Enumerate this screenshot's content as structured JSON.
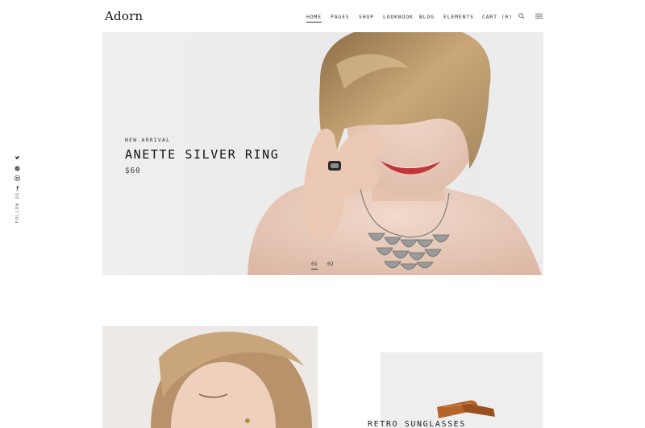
{
  "brand": {
    "logo": "Adorn"
  },
  "nav": {
    "items": [
      {
        "label": "HOME",
        "active": true
      },
      {
        "label": "PAGES",
        "active": false
      },
      {
        "label": "SHOP",
        "active": false
      },
      {
        "label": "LOOKBOOK",
        "active": false
      },
      {
        "label": "BLOG",
        "active": false
      },
      {
        "label": "ELEMENTS",
        "active": false
      },
      {
        "label": "CART (0)",
        "active": false
      }
    ],
    "icons": [
      "search-icon",
      "hamburger-menu-icon"
    ]
  },
  "social": {
    "label": "FOLLOW US:",
    "icons": [
      "twitter-icon",
      "pinterest-icon",
      "instagram-icon",
      "facebook-icon"
    ]
  },
  "hero": {
    "eyebrow": "NEW ARRIVAL",
    "title": "ANETTE SILVER RING",
    "price": "$60",
    "slides": [
      "01",
      "02"
    ],
    "active_slide": "01"
  },
  "feature": {
    "right_label": "RETRO SUNGLASSES"
  },
  "colors": {
    "text": "#111111",
    "hero_bg": "#ececec",
    "card_bg": "#eeeeee"
  }
}
